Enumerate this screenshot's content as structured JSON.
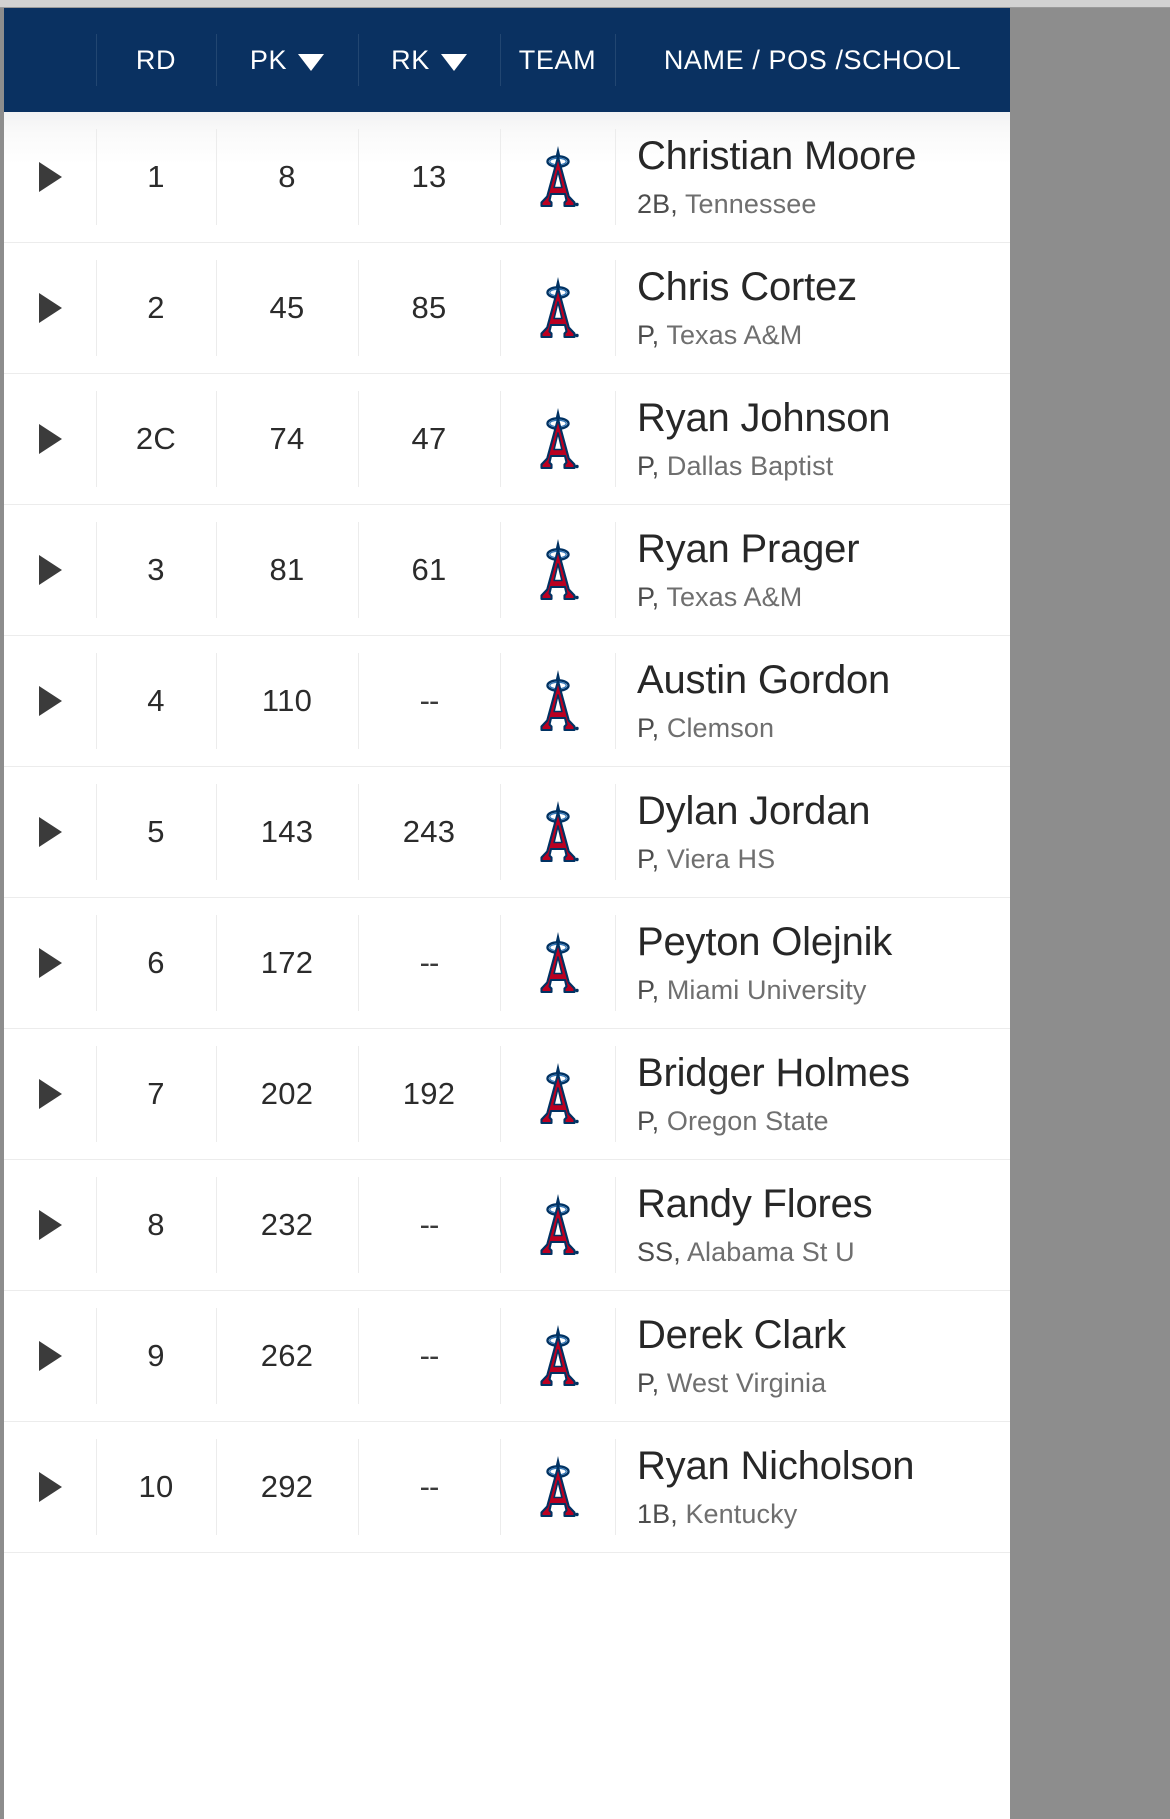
{
  "table": {
    "columns": [
      {
        "key": "expand",
        "label": "",
        "sortable": false,
        "icon": "expand-triangle-icon"
      },
      {
        "key": "rd",
        "label": "RD",
        "sortable": false
      },
      {
        "key": "pk",
        "label": "PK",
        "sortable": true,
        "sort_icon": "caret-down-icon"
      },
      {
        "key": "rk",
        "label": "RK",
        "sortable": true,
        "sort_icon": "caret-down-icon"
      },
      {
        "key": "team",
        "label": "TEAM",
        "sortable": false
      },
      {
        "key": "name",
        "label": "NAME / POS /SCHOOL",
        "sortable": false
      }
    ],
    "header_bg": "#0a3161",
    "header_text": "#ffffff",
    "row_separator": "#ececec",
    "team_logo": {
      "name": "los-angeles-angels-logo",
      "primary": "#BA0021",
      "outline": "#003263",
      "halo": "#005A9C"
    },
    "rows": [
      {
        "rd": "1",
        "pk": "8",
        "rk": "13",
        "team": "Los Angeles Angels",
        "name": "Christian Moore",
        "pos": "2B",
        "school": "Tennessee"
      },
      {
        "rd": "2",
        "pk": "45",
        "rk": "85",
        "team": "Los Angeles Angels",
        "name": "Chris Cortez",
        "pos": "P",
        "school": "Texas A&M"
      },
      {
        "rd": "2C",
        "pk": "74",
        "rk": "47",
        "team": "Los Angeles Angels",
        "name": "Ryan Johnson",
        "pos": "P",
        "school": "Dallas Baptist"
      },
      {
        "rd": "3",
        "pk": "81",
        "rk": "61",
        "team": "Los Angeles Angels",
        "name": "Ryan Prager",
        "pos": "P",
        "school": "Texas A&M"
      },
      {
        "rd": "4",
        "pk": "110",
        "rk": "--",
        "team": "Los Angeles Angels",
        "name": "Austin Gordon",
        "pos": "P",
        "school": "Clemson"
      },
      {
        "rd": "5",
        "pk": "143",
        "rk": "243",
        "team": "Los Angeles Angels",
        "name": "Dylan Jordan",
        "pos": "P",
        "school": "Viera HS"
      },
      {
        "rd": "6",
        "pk": "172",
        "rk": "--",
        "team": "Los Angeles Angels",
        "name": "Peyton Olejnik",
        "pos": "P",
        "school": "Miami University"
      },
      {
        "rd": "7",
        "pk": "202",
        "rk": "192",
        "team": "Los Angeles Angels",
        "name": "Bridger Holmes",
        "pos": "P",
        "school": "Oregon State"
      },
      {
        "rd": "8",
        "pk": "232",
        "rk": "--",
        "team": "Los Angeles Angels",
        "name": "Randy Flores",
        "pos": "SS",
        "school": "Alabama St U"
      },
      {
        "rd": "9",
        "pk": "262",
        "rk": "--",
        "team": "Los Angeles Angels",
        "name": "Derek Clark",
        "pos": "P",
        "school": "West Virginia"
      },
      {
        "rd": "10",
        "pk": "292",
        "rk": "--",
        "team": "Los Angeles Angels",
        "name": "Ryan Nicholson",
        "pos": "1B",
        "school": "Kentucky"
      }
    ]
  }
}
